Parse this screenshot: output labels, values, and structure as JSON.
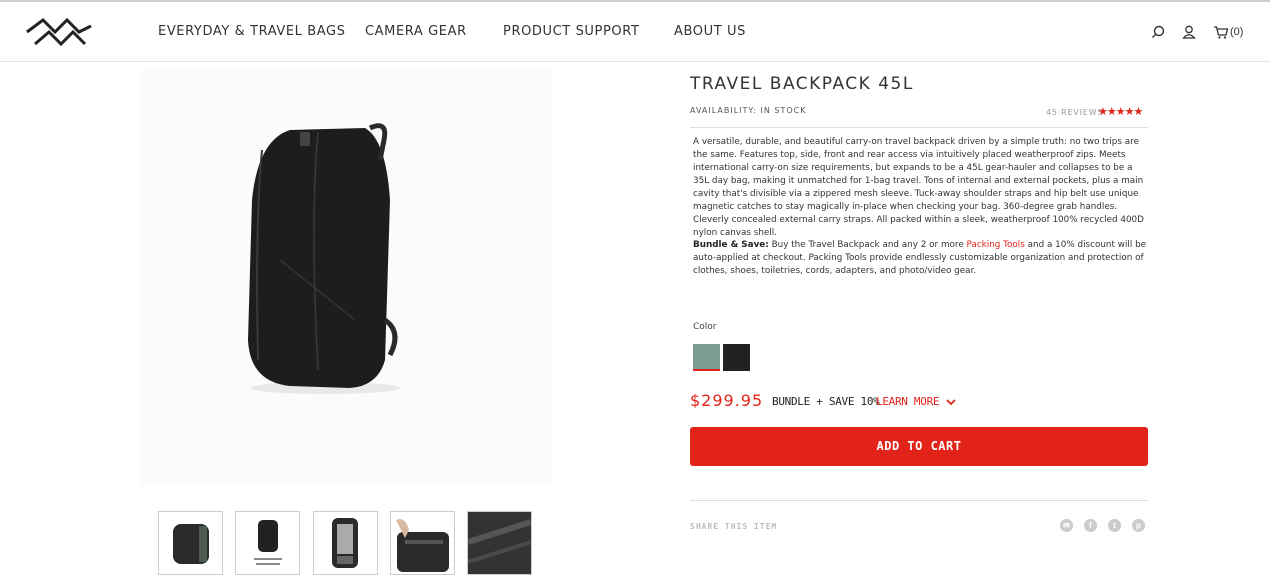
{
  "nav": {
    "items": [
      "EVERYDAY & TRAVEL BAGS",
      "CAMERA GEAR",
      "PRODUCT SUPPORT",
      "ABOUT US"
    ],
    "cart_count": "(0)",
    "icons": [
      "search-icon",
      "user-icon",
      "cart-icon"
    ]
  },
  "product": {
    "title": "TRAVEL BACKPACK 45L",
    "availability": "AVAILABILITY: IN STOCK",
    "reviews": "45 REVIEWS",
    "rating": 5,
    "stars": "★★★★★",
    "description": "A versatile, durable, and beautiful carry-on travel backpack driven by a simple truth: no two trips are the same. Features top, side, front and rear access via intuitively placed weatherproof zips. Meets international carry-on size requirements, but expands to be a 45L gear-hauler and collapses to be a 35L day bag, making it unmatched for 1-bag travel. Tons of internal and external pockets, plus a main cavity that's divisible via a zippered mesh sleeve. Tuck-away shoulder straps and hip belt use unique magnetic catches to stay magically in-place when checking your bag. 360-degree grab handles. Cleverly concealed external carry straps. All packed within a sleek, weatherproof 100% recycled 400D nylon canvas shell.",
    "bundle_label": "Bundle & Save:",
    "bundle_text_1": " Buy the Travel Backpack and any 2 or more ",
    "bundle_link": "Packing Tools",
    "bundle_text_2": " and a 10% discount will be auto-applied at checkout. Packing Tools provide endlessly customizable organization and protection of clothes, shoes, toiletries, cords, adapters, and photo/video gear.",
    "color_label": "Color",
    "colors": [
      {
        "name": "sage",
        "hex": "#7a9e94",
        "selected": true
      },
      {
        "name": "black",
        "hex": "#222222",
        "selected": false
      }
    ],
    "price": "$299.95",
    "bundle_save": "BUNDLE + SAVE 10%",
    "learn_more": "LEARN MORE",
    "add_to_cart": "ADD TO CART",
    "share_label": "SHARE THIS ITEM",
    "social_icons": [
      "email-icon",
      "facebook-icon",
      "twitter-icon",
      "pinterest-icon"
    ]
  },
  "colors": {
    "accent": "#e2231a",
    "text": "#333333"
  }
}
